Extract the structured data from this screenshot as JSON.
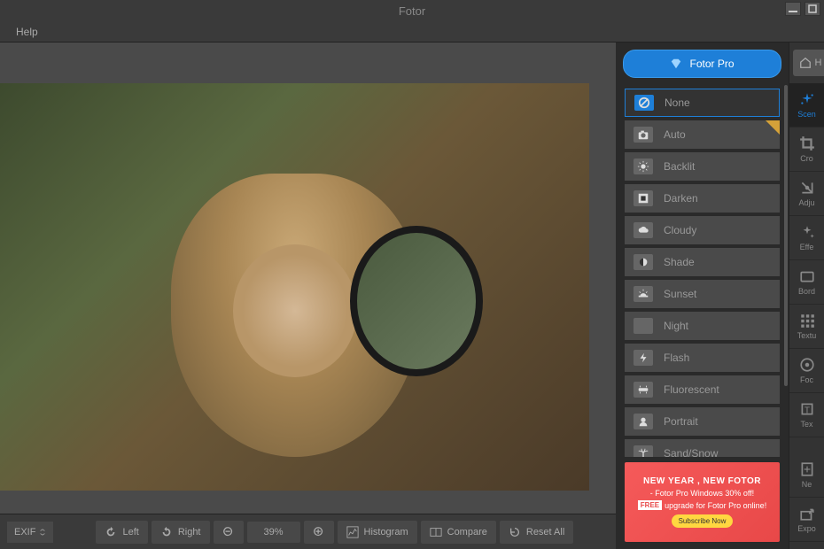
{
  "app": {
    "title": "Fotor"
  },
  "menu": {
    "help": "Help"
  },
  "pro_button": "Fotor Pro",
  "home_button": "H",
  "presets": {
    "items": [
      {
        "label": "None",
        "icon": "none",
        "selected": true
      },
      {
        "label": "Auto",
        "icon": "camera",
        "pro": true
      },
      {
        "label": "Backlit",
        "icon": "sun-camera"
      },
      {
        "label": "Darken",
        "icon": "darken"
      },
      {
        "label": "Cloudy",
        "icon": "cloud"
      },
      {
        "label": "Shade",
        "icon": "shade"
      },
      {
        "label": "Sunset",
        "icon": "sunset"
      },
      {
        "label": "Night",
        "icon": "moon"
      },
      {
        "label": "Flash",
        "icon": "flash"
      },
      {
        "label": "Fluorescent",
        "icon": "fluorescent"
      },
      {
        "label": "Portrait",
        "icon": "portrait"
      },
      {
        "label": "Sand/Snow",
        "icon": "palm"
      }
    ]
  },
  "tools": {
    "items": [
      {
        "label": "Scen",
        "icon": "sparkle"
      },
      {
        "label": "Cro",
        "icon": "crop"
      },
      {
        "label": "Adju",
        "icon": "adjust"
      },
      {
        "label": "Effe",
        "icon": "effects"
      },
      {
        "label": "Bord",
        "icon": "border"
      },
      {
        "label": "Textu",
        "icon": "texture"
      },
      {
        "label": "Foc",
        "icon": "focus"
      },
      {
        "label": "Tex",
        "icon": "text"
      },
      {
        "label": "Ne",
        "icon": "new"
      },
      {
        "label": "Expo",
        "icon": "export"
      }
    ]
  },
  "toolbar": {
    "exif": "EXIF",
    "left": "Left",
    "right": "Right",
    "zoom": "39%",
    "histogram": "Histogram",
    "compare": "Compare",
    "reset": "Reset  All"
  },
  "promo": {
    "title": "NEW YEAR , NEW FOTOR",
    "line1": "- Fotor Pro Windows 30% off!",
    "line2": "upgrade for Fotor Pro online!",
    "free": "FREE",
    "cta": "Subscribe Now"
  }
}
